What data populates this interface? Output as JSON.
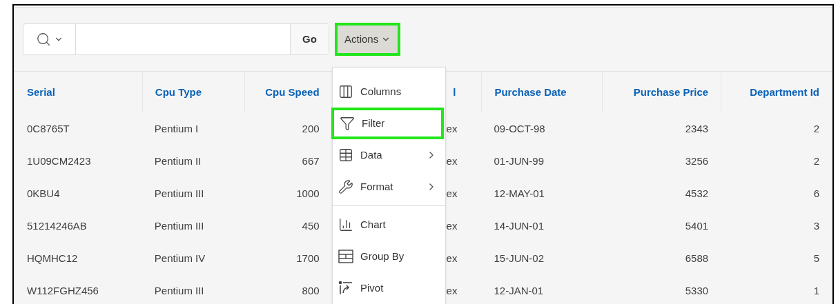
{
  "toolbar": {
    "go_button": "Go",
    "actions_button": {
      "label": "Actions",
      "highlighted": true
    }
  },
  "table": {
    "columns": [
      {
        "label": "Serial",
        "numeric": false
      },
      {
        "label": "Cpu Type",
        "numeric": false
      },
      {
        "label": "Cpu Speed",
        "numeric": true
      },
      {
        "label": "l"
      },
      {
        "label": "Purchase Date",
        "numeric": false
      },
      {
        "label": "Purchase Price",
        "numeric": true
      },
      {
        "label": "Department Id",
        "numeric": true
      }
    ],
    "rows": [
      [
        "0C8765T",
        "Pentium I",
        "200",
        "ex",
        "09-OCT-98",
        "2343",
        "2"
      ],
      [
        "1U09CM2423",
        "Pentium II",
        "667",
        "ex",
        "01-JUN-99",
        "3256",
        "2"
      ],
      [
        "0KBU4",
        "Pentium III",
        "1000",
        "ex",
        "12-MAY-01",
        "4532",
        "6"
      ],
      [
        "51214246AB",
        "Pentium III",
        "450",
        "ex",
        "14-JUN-01",
        "5401",
        "3"
      ],
      [
        "HQMHC12",
        "Pentium IV",
        "1700",
        "ex",
        "15-JUN-02",
        "6588",
        "5"
      ],
      [
        "W112FGHZ456",
        "Pentium III",
        "800",
        "ex",
        "12-JAN-01",
        "5330",
        "1"
      ]
    ]
  },
  "actions_menu": {
    "sections": [
      [
        {
          "label": "Columns",
          "submenu": false,
          "highlighted": false
        },
        {
          "label": "Filter",
          "submenu": false,
          "highlighted": true
        },
        {
          "label": "Data",
          "submenu": true,
          "highlighted": false
        },
        {
          "label": "Format",
          "submenu": true,
          "highlighted": false
        }
      ],
      [
        {
          "label": "Chart",
          "submenu": false,
          "highlighted": false
        },
        {
          "label": "Group By",
          "submenu": false,
          "highlighted": false
        },
        {
          "label": "Pivot",
          "submenu": false,
          "highlighted": false
        }
      ]
    ]
  }
}
